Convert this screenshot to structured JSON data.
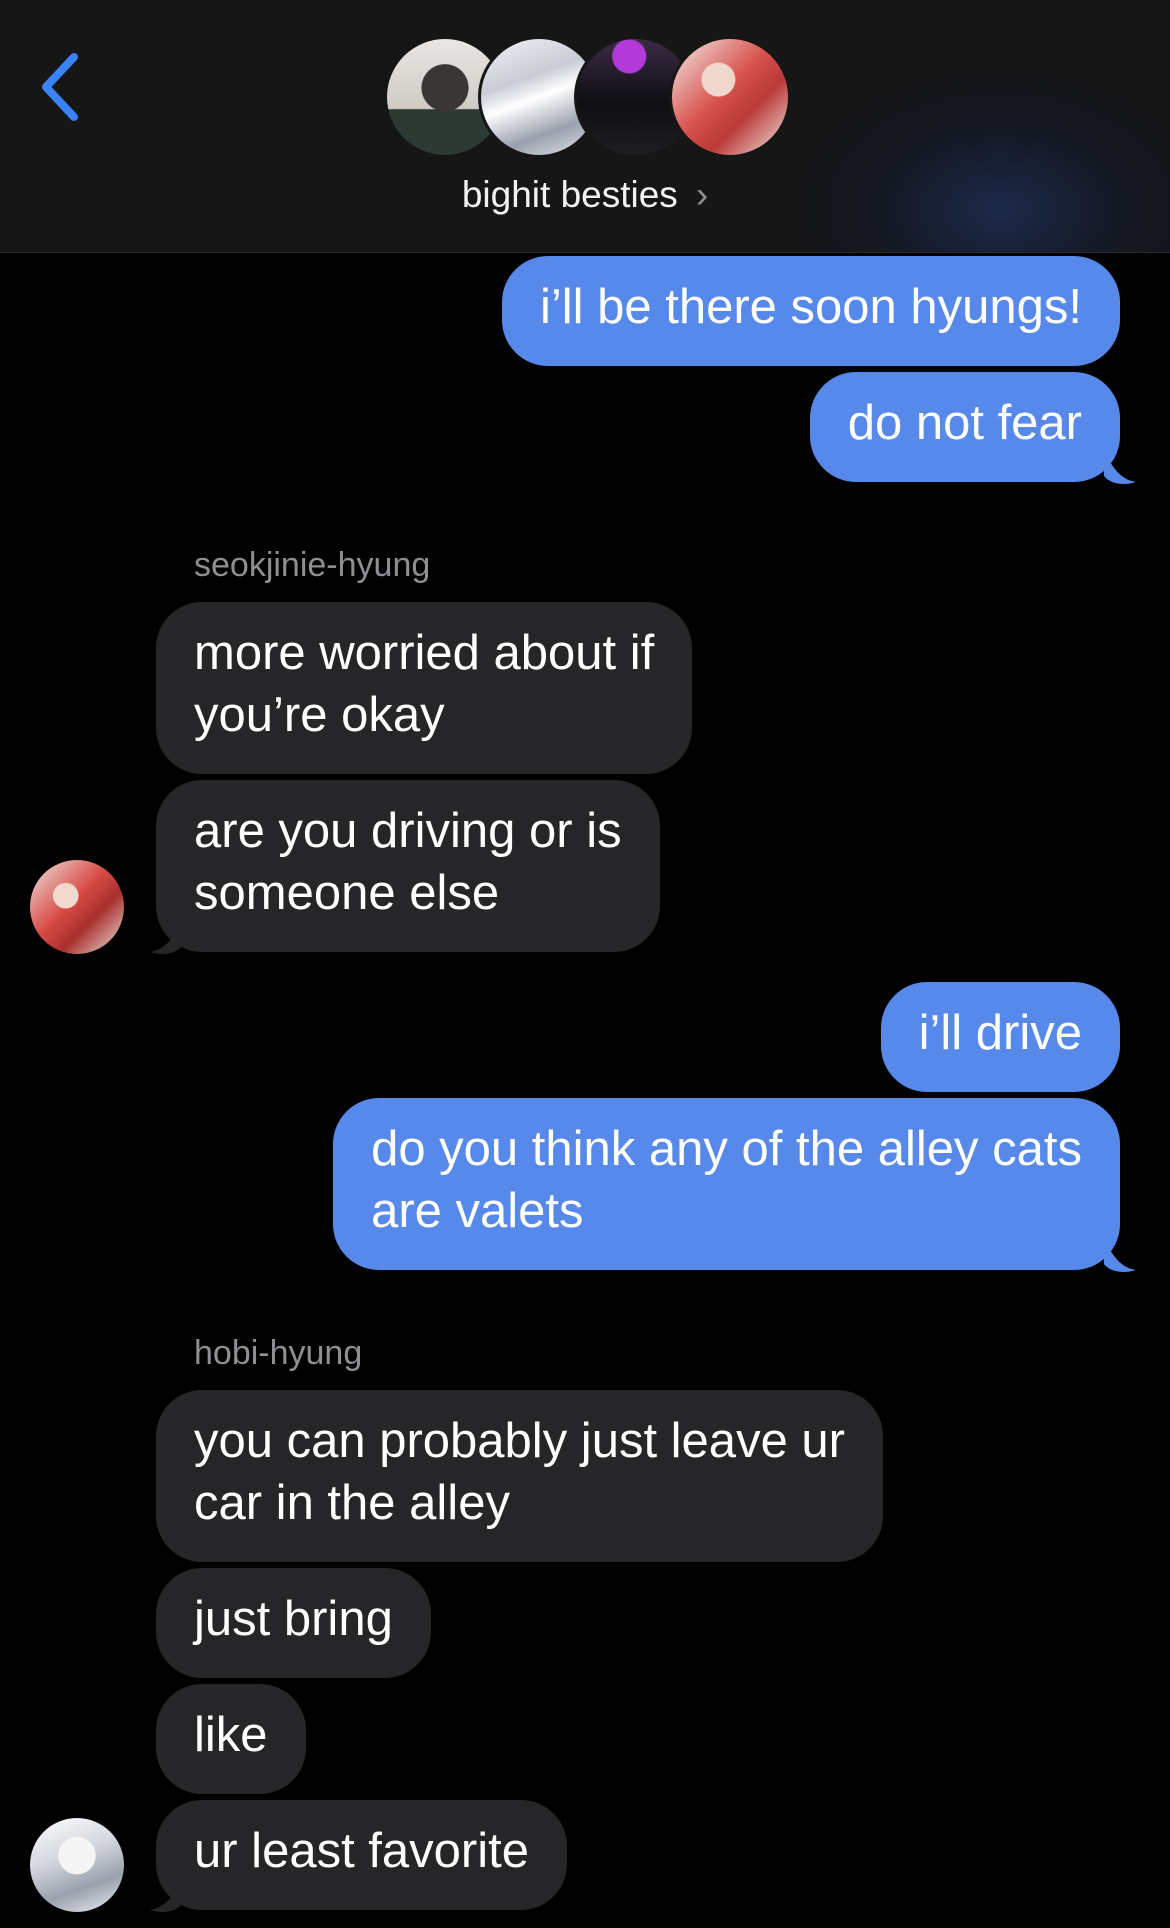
{
  "header": {
    "group_name": "bighit besties",
    "chevron": "›",
    "back_icon": "chevron-left-icon",
    "avatar_count": 4
  },
  "colors": {
    "sent_bubble": "#5689ea",
    "received_bubble": "#262628",
    "accent": "#3a82f7",
    "background": "#000000"
  },
  "messages": [
    {
      "from": "me",
      "text": "i’ll be there soon hyungs!"
    },
    {
      "from": "me",
      "text": "do not fear"
    },
    {
      "sender_label": "seokjinie-hyung"
    },
    {
      "from": "seokjinie-hyung",
      "text": "more worried about if\nyou’re okay"
    },
    {
      "from": "seokjinie-hyung",
      "text": "are you driving or is\nsomeone else"
    },
    {
      "from": "me",
      "text": "i’ll drive"
    },
    {
      "from": "me",
      "text": "do you think any of the alley cats\nare valets"
    },
    {
      "sender_label": "hobi-hyung"
    },
    {
      "from": "hobi-hyung",
      "text": "you can probably just leave ur\ncar in the alley"
    },
    {
      "from": "hobi-hyung",
      "text": "just bring"
    },
    {
      "from": "hobi-hyung",
      "text": "like"
    },
    {
      "from": "hobi-hyung",
      "text": "ur least favorite"
    }
  ]
}
